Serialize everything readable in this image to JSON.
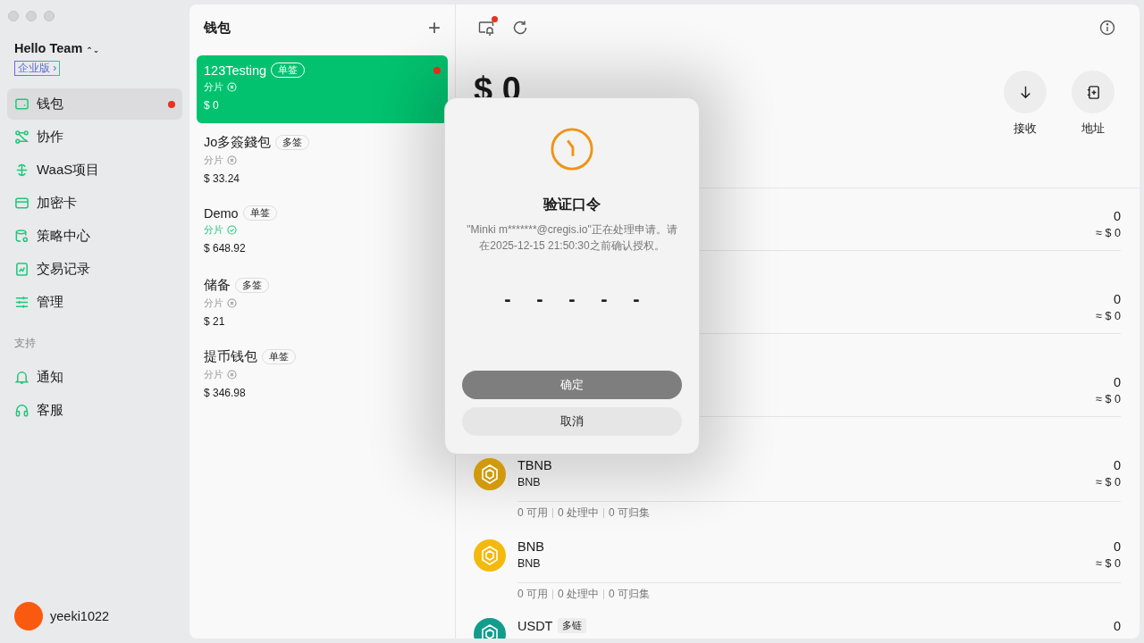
{
  "sidebar": {
    "team": "Hello Team",
    "team_switch": "⌃⌄",
    "plan_badge": "企业版 ›",
    "items": [
      {
        "label": "钱包",
        "selected": true,
        "dot": true
      },
      {
        "label": "协作",
        "selected": false,
        "dot": false
      },
      {
        "label": "WaaS项目",
        "selected": false,
        "dot": false
      },
      {
        "label": "加密卡",
        "selected": false,
        "dot": false
      },
      {
        "label": "策略中心",
        "selected": false,
        "dot": false
      },
      {
        "label": "交易记录",
        "selected": false,
        "dot": false
      },
      {
        "label": "管理",
        "selected": false,
        "dot": false
      }
    ],
    "support_heading": "支持",
    "support_items": [
      {
        "label": "通知",
        "selected": false,
        "dot": false
      },
      {
        "label": "客服",
        "selected": false,
        "dot": false
      }
    ],
    "user": {
      "name": "yeeki1022"
    }
  },
  "wallets": {
    "title": "钱包",
    "add": "+",
    "items": [
      {
        "name": "123Testing",
        "tag": "单签",
        "shard": "分片",
        "shard_ok": false,
        "amount": "$ 0",
        "selected": true,
        "dot": true
      },
      {
        "name": "Jo多簽錢包",
        "tag": "多签",
        "shard": "分片",
        "shard_ok": false,
        "amount": "$ 33.24",
        "selected": false,
        "dot": false
      },
      {
        "name": "Demo",
        "tag": "单签",
        "shard": "分片",
        "shard_ok": true,
        "amount": "$ 648.92",
        "selected": false,
        "dot": false
      },
      {
        "name": "储备",
        "tag": "多签",
        "shard": "分片",
        "shard_ok": false,
        "amount": "$ 21",
        "selected": false,
        "dot": false
      },
      {
        "name": "提币钱包",
        "tag": "单签",
        "shard": "分片",
        "shard_ok": false,
        "amount": "$ 346.98",
        "selected": false,
        "dot": false
      }
    ]
  },
  "main": {
    "toolbar": {
      "device_dot": true
    },
    "balance": "$ 0",
    "actions": [
      {
        "label": "接收"
      },
      {
        "label": "地址"
      }
    ],
    "assets": [
      {
        "amount": "0",
        "fiat": "≈ $ 0"
      },
      {
        "amount": "0",
        "fiat": "≈ $ 0"
      },
      {
        "amount": "0",
        "fiat": "≈ $ 0"
      },
      {
        "name": "TBNB",
        "symbol": "BNB",
        "color": "#d19a0c",
        "amount": "0",
        "fiat": "≈ $ 0",
        "stats": [
          "0 可用",
          "0 处理中",
          "0 可归集"
        ]
      },
      {
        "name": "BNB",
        "symbol": "BNB",
        "color": "#f3b90d",
        "amount": "0",
        "fiat": "≈ $ 0",
        "stats": [
          "0 可用",
          "0 处理中",
          "0 可归集"
        ]
      },
      {
        "name": "USDT",
        "tag": "多链",
        "color": "#129c8c",
        "amount": "0"
      }
    ]
  },
  "dialog": {
    "title": "验证口令",
    "message": "\"Minki m*******@cregis.io\"正在处理申请。请在2025-12-15 21:50:30之前确认授权。",
    "code_slots": [
      "-",
      "-",
      "-",
      "-",
      "-"
    ],
    "confirm": {
      "label": "确定",
      "disabled": true
    },
    "cancel": "取消"
  }
}
